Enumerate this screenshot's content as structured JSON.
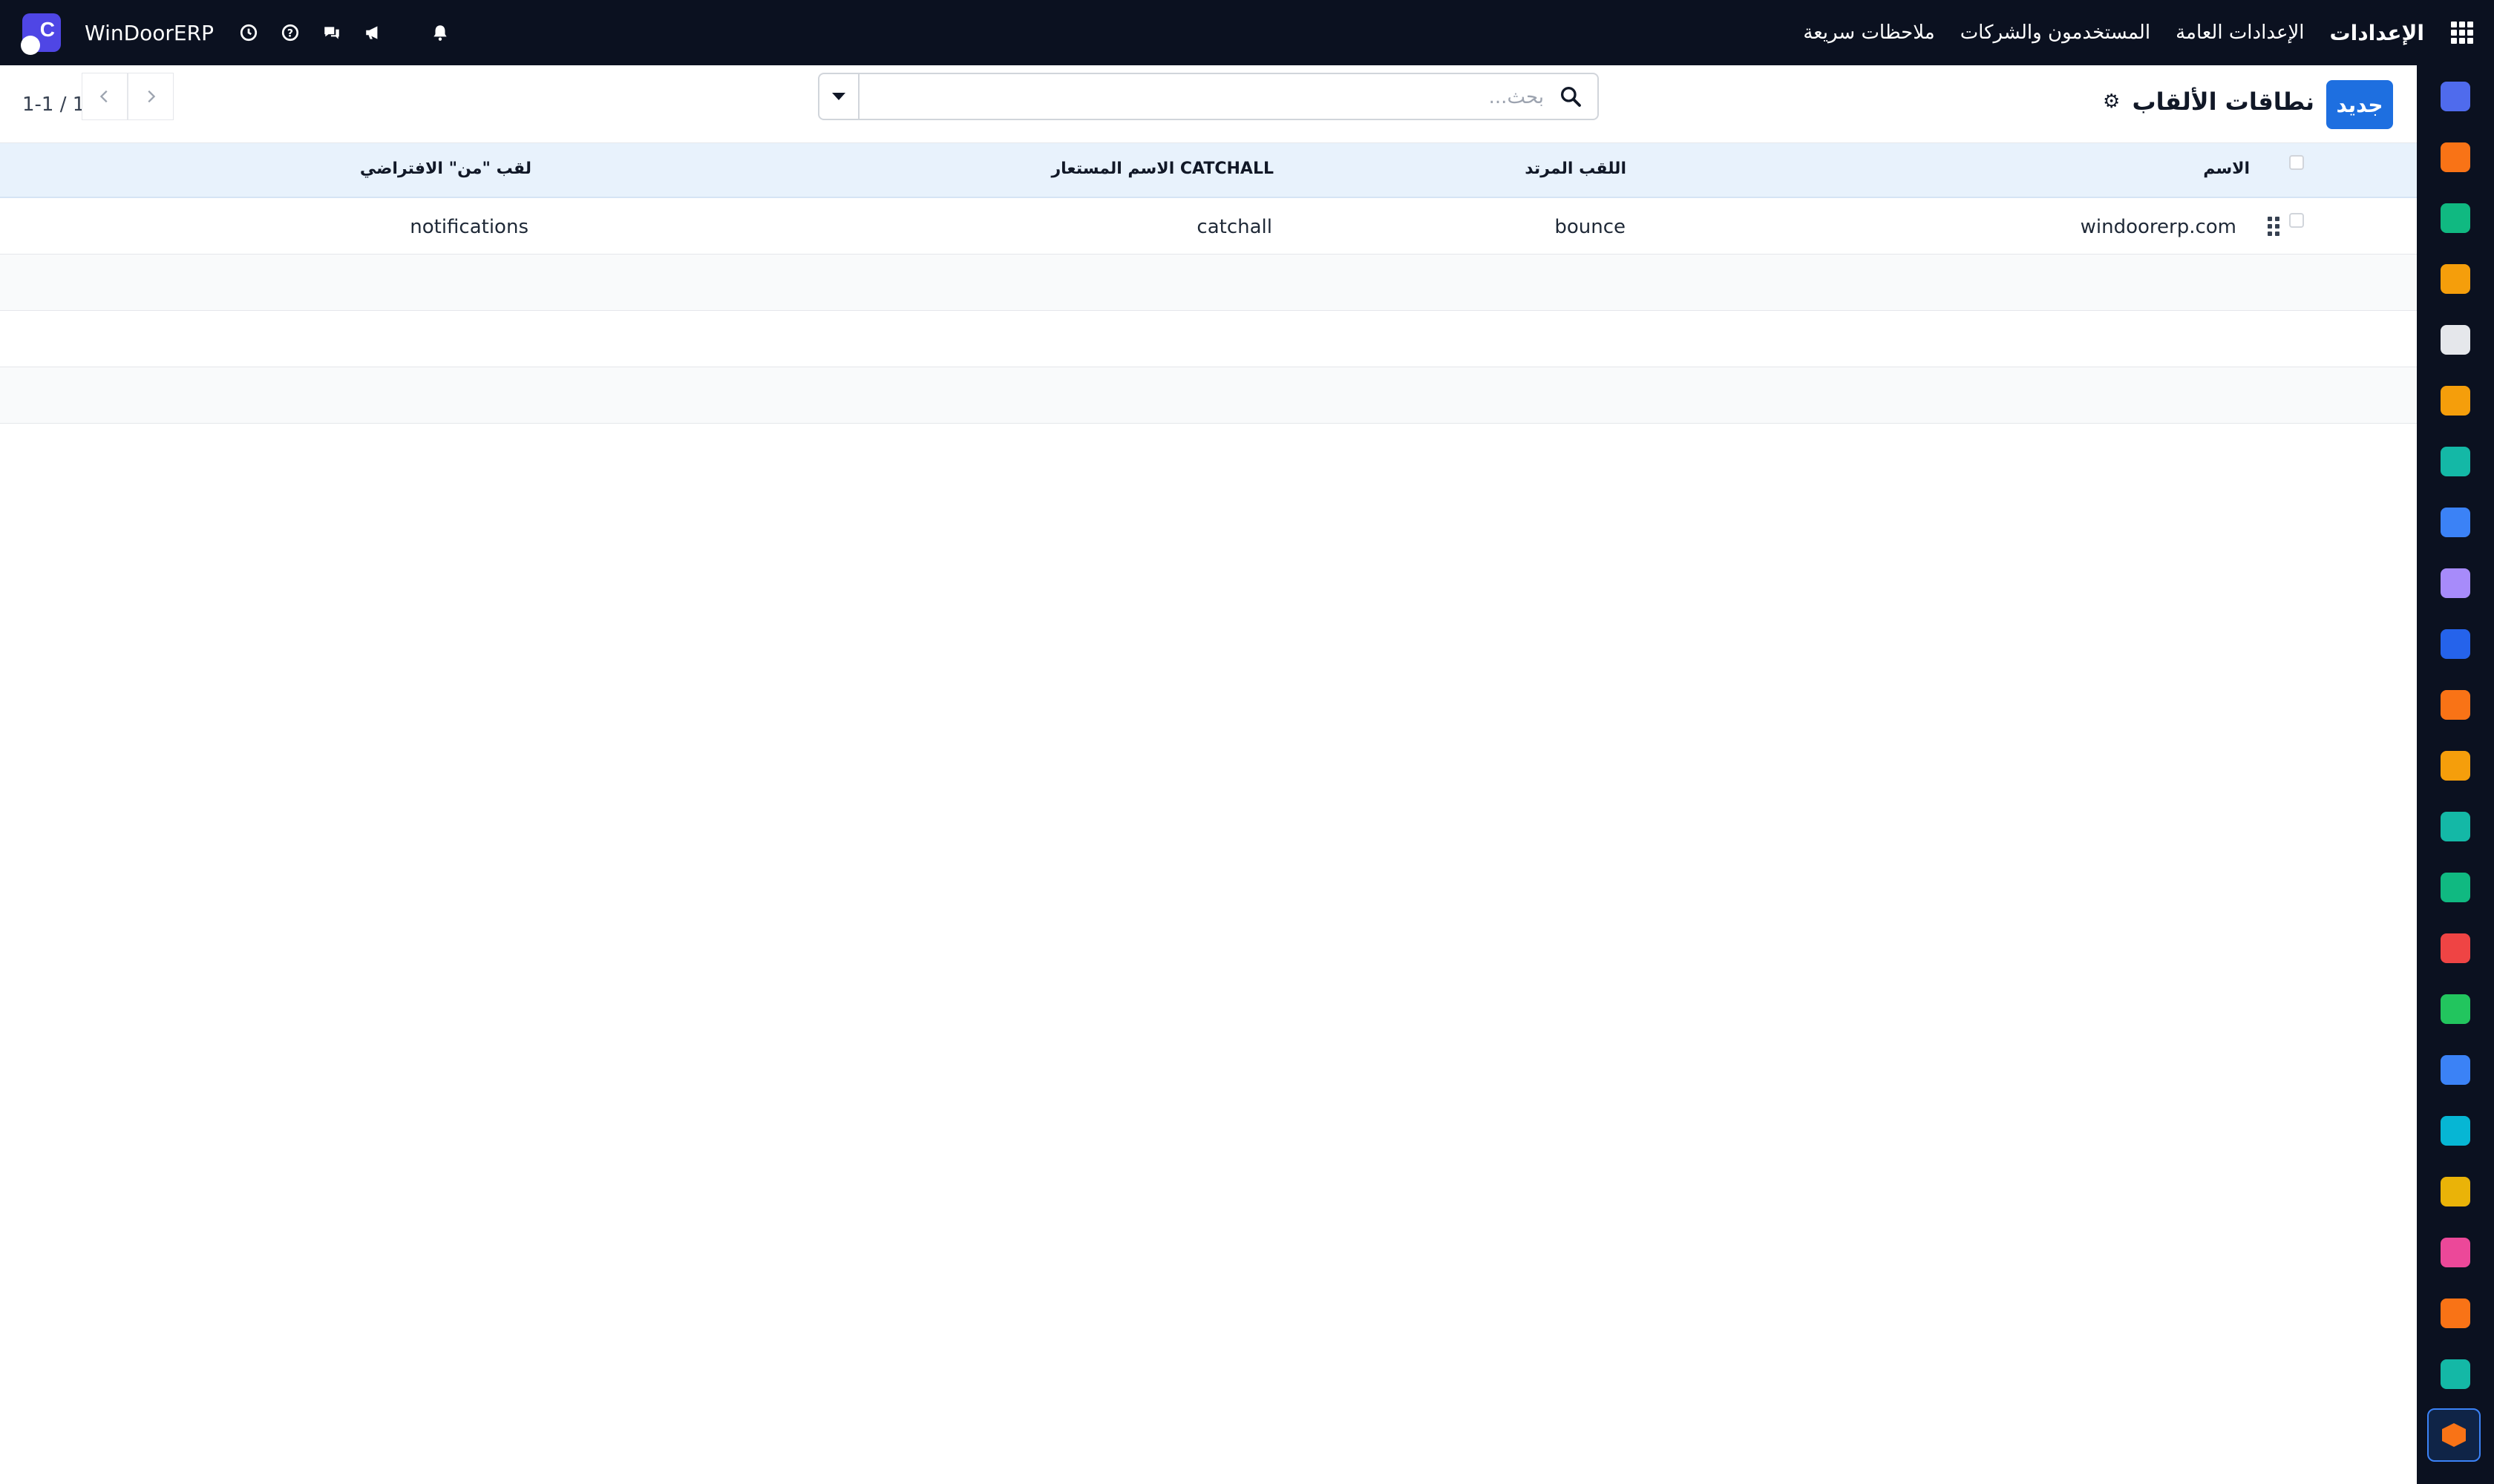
{
  "navbar": {
    "title": "الإعدادات",
    "menu": [
      "الإعدادات العامة",
      "المستخدمون والشركات",
      "ملاحظات سريعة"
    ],
    "company": "WinDoorERP",
    "icons": [
      "apps-icon",
      "logo",
      "clock-icon",
      "help-icon",
      "chat-icon",
      "megaphone-icon",
      "bell-icon"
    ]
  },
  "control_panel": {
    "new_button": "جديد",
    "title": "نطاقات الألقاب",
    "search_placeholder": "بحث...",
    "pager": "1-1 / 1"
  },
  "table": {
    "columns": [
      "الاسم",
      "اللقب المرتد",
      "الاسم المستعار CATCHALL",
      "لقب \"من\" الافتراضي"
    ],
    "rows": [
      {
        "name": "windoorerp.com",
        "bounce": "bounce",
        "catchall": "catchall",
        "default_from": "notifications"
      }
    ],
    "empty_rows": 3
  },
  "sidebar_apps": [
    {
      "name": "mail-app-icon",
      "color": "#4f6bed"
    },
    {
      "name": "discuss-app-icon",
      "color": "#f97316"
    },
    {
      "name": "sales-app-icon",
      "color": "#10b981"
    },
    {
      "name": "reports-app-icon",
      "color": "#f59e0b"
    },
    {
      "name": "inventory-app-icon",
      "color": "#e5e7eb"
    },
    {
      "name": "employees-app-icon",
      "color": "#f59e0b"
    },
    {
      "name": "tasks-app-icon",
      "color": "#14b8a6"
    },
    {
      "name": "knowledge-app-icon",
      "color": "#3b82f6"
    },
    {
      "name": "products-app-icon",
      "color": "#a78bfa"
    },
    {
      "name": "invoicing-app-icon",
      "color": "#2563eb"
    },
    {
      "name": "contacts-app-icon",
      "color": "#f97316"
    },
    {
      "name": "calendar-app-icon",
      "color": "#f59e0b"
    },
    {
      "name": "sign-app-icon",
      "color": "#14b8a6"
    },
    {
      "name": "directory-app-icon",
      "color": "#10b981"
    },
    {
      "name": "dashboards-app-icon",
      "color": "#ef4444"
    },
    {
      "name": "whatsapp-app-icon",
      "color": "#22c55e"
    },
    {
      "name": "timesheets-app-icon",
      "color": "#3b82f6"
    },
    {
      "name": "website-app-icon",
      "color": "#06b6d4"
    },
    {
      "name": "telegram-app-icon",
      "color": "#eab308"
    },
    {
      "name": "accounting-app-icon",
      "color": "#ec4899"
    },
    {
      "name": "manufacturing-app-icon",
      "color": "#f97316"
    },
    {
      "name": "planning-app-icon",
      "color": "#14b8a6"
    },
    {
      "name": "settings-app-icon",
      "color": "#f97316"
    }
  ]
}
